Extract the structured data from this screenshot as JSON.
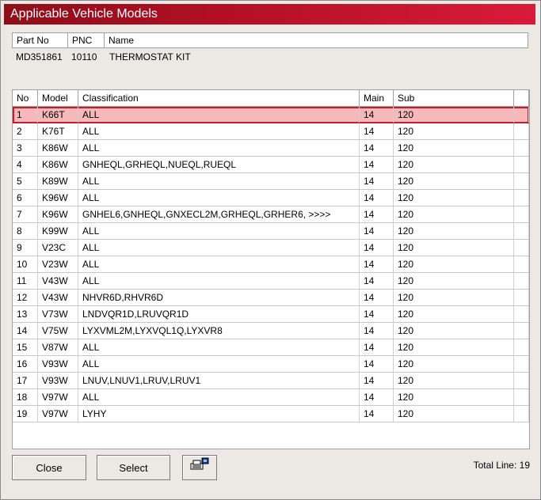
{
  "window": {
    "title": "Applicable Vehicle Models"
  },
  "part": {
    "headers": [
      "Part No",
      "PNC",
      "Name"
    ],
    "values": [
      "MD351861",
      "10110",
      "THERMOSTAT KIT"
    ]
  },
  "grid": {
    "columns": [
      "No",
      "Model",
      "Classification",
      "Main",
      "Sub"
    ],
    "selected_row": 1,
    "rows": [
      [
        "1",
        "K66T",
        "ALL",
        "14",
        "120"
      ],
      [
        "2",
        "K76T",
        "ALL",
        "14",
        "120"
      ],
      [
        "3",
        "K86W",
        "ALL",
        "14",
        "120"
      ],
      [
        "4",
        "K86W",
        "GNHEQL,GRHEQL,NUEQL,RUEQL",
        "14",
        "120"
      ],
      [
        "5",
        "K89W",
        "ALL",
        "14",
        "120"
      ],
      [
        "6",
        "K96W",
        "ALL",
        "14",
        "120"
      ],
      [
        "7",
        "K96W",
        "GNHEL6,GNHEQL,GNXECL2M,GRHEQL,GRHER6,  >>>>",
        "14",
        "120"
      ],
      [
        "8",
        "K99W",
        "ALL",
        "14",
        "120"
      ],
      [
        "9",
        "V23C",
        "ALL",
        "14",
        "120"
      ],
      [
        "10",
        "V23W",
        "ALL",
        "14",
        "120"
      ],
      [
        "11",
        "V43W",
        "ALL",
        "14",
        "120"
      ],
      [
        "12",
        "V43W",
        "NHVR6D,RHVR6D",
        "14",
        "120"
      ],
      [
        "13",
        "V73W",
        "LNDVQR1D,LRUVQR1D",
        "14",
        "120"
      ],
      [
        "14",
        "V75W",
        "LYXVML2M,LYXVQL1Q,LYXVR8",
        "14",
        "120"
      ],
      [
        "15",
        "V87W",
        "ALL",
        "14",
        "120"
      ],
      [
        "16",
        "V93W",
        "ALL",
        "14",
        "120"
      ],
      [
        "17",
        "V93W",
        "LNUV,LNUV1,LRUV,LRUV1",
        "14",
        "120"
      ],
      [
        "18",
        "V97W",
        "ALL",
        "14",
        "120"
      ],
      [
        "19",
        "V97W",
        "LYHY",
        "14",
        "120"
      ]
    ]
  },
  "buttons": {
    "close": "Close",
    "select": "Select",
    "print_icon": "printer-icon"
  },
  "footer": {
    "total": "Total Line: 19"
  },
  "colors": {
    "title_start": "#8e0e1a",
    "title_end": "#d81b3a",
    "selected_fill": "#f6b8b8",
    "selected_border": "#c21f2e"
  }
}
